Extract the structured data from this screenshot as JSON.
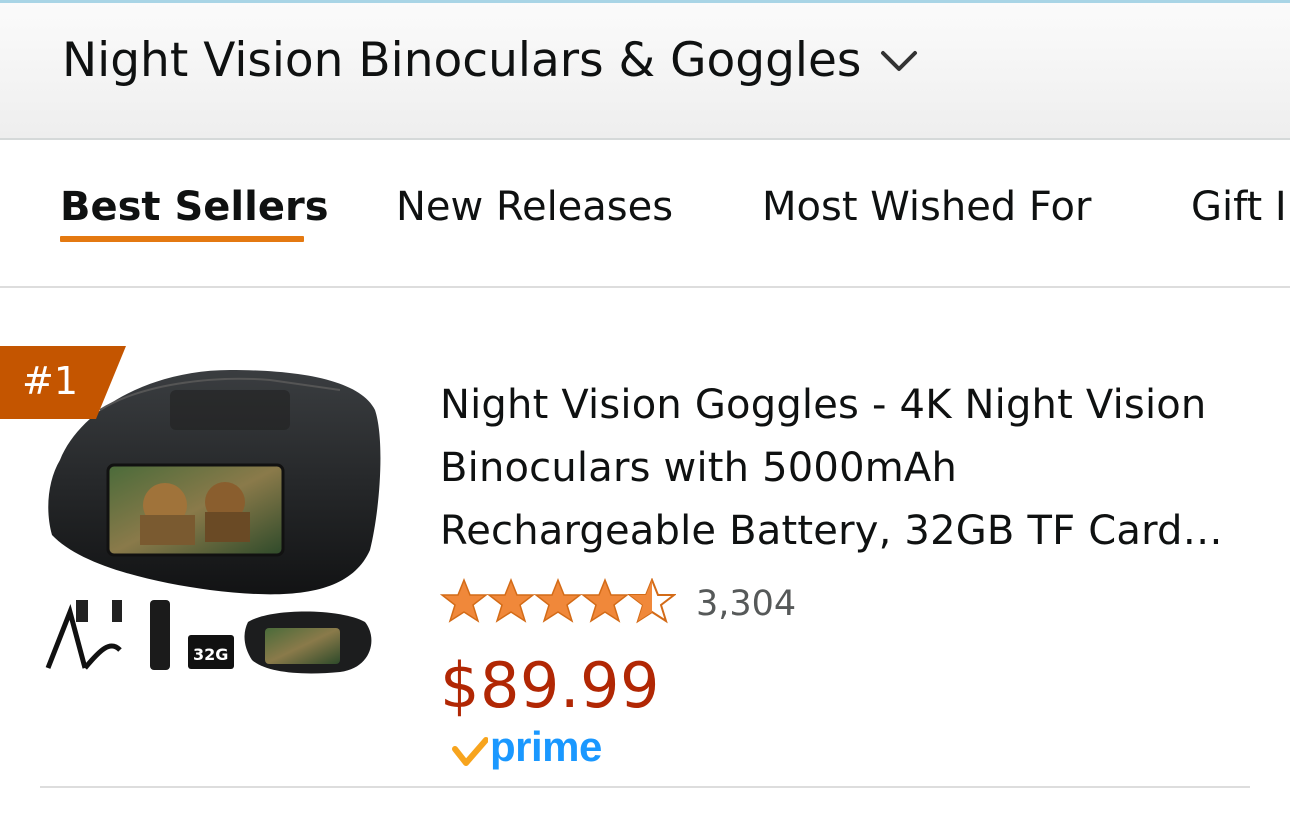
{
  "category": {
    "title": "Night Vision Binoculars & Goggles",
    "chevron_icon": "chevron-down-icon"
  },
  "tabs": [
    {
      "label": "Best Sellers",
      "active": true
    },
    {
      "label": "New Releases",
      "active": false
    },
    {
      "label": "Most Wished For",
      "active": false
    },
    {
      "label": "Gift I",
      "active": false
    }
  ],
  "colors": {
    "accent_orange": "#e47911",
    "badge_orange": "#c45500",
    "price_red": "#b12704",
    "star": "#f0883a",
    "prime_blue": "#1a98ff"
  },
  "product": {
    "rank": "#1",
    "title_lines": [
      "Night Vision Goggles - 4K Night Vision",
      "Binoculars with 5000mAh",
      "Rechargeable Battery, 32GB TF Card…"
    ],
    "rating_stars": 4.5,
    "rating_count": "3,304",
    "price": "$89.99",
    "prime_label": "prime",
    "image_caption": "32G"
  }
}
